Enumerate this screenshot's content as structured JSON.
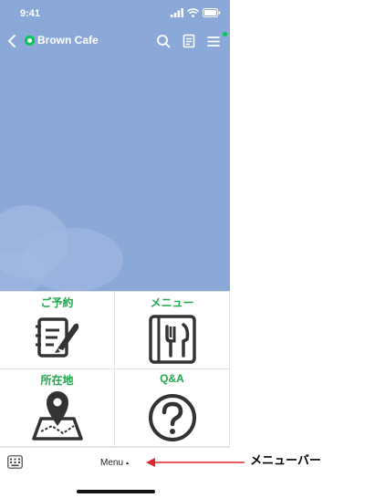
{
  "status_bar": {
    "time": "9:41"
  },
  "header": {
    "title": "Brown Cafe"
  },
  "rich_menu": {
    "items": [
      {
        "label": "ご予約",
        "icon": "reservation-notepad-icon"
      },
      {
        "label": "メニュー",
        "icon": "menu-cutlery-icon"
      },
      {
        "label": "所在地",
        "icon": "location-map-pin-icon"
      },
      {
        "label": "Q&A",
        "icon": "question-mark-icon"
      }
    ]
  },
  "menu_bar": {
    "label": "Menu",
    "caret": "▴"
  },
  "annotation": {
    "label": "メニューバー"
  },
  "colors": {
    "chat_background": "#8aa8d8",
    "accent_green": "#1fa74d",
    "line_green": "#06c755",
    "annotation_arrow": "#e0262a"
  }
}
